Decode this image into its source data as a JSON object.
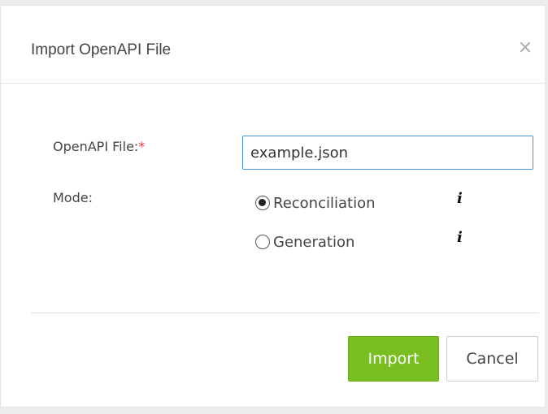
{
  "dialog": {
    "title": "Import OpenAPI File",
    "close_glyph": "×",
    "close_icon": "close-icon"
  },
  "form": {
    "file_label": "OpenAPI File:",
    "required_marker": "*",
    "file_value": "example.json",
    "mode_label": "Mode:",
    "modes": [
      {
        "label": "Reconciliation",
        "checked": true,
        "info_glyph": "i",
        "info_icon": "info-icon"
      },
      {
        "label": "Generation",
        "checked": false,
        "info_glyph": "i",
        "info_icon": "info-icon"
      }
    ]
  },
  "footer": {
    "import_label": "Import",
    "cancel_label": "Cancel"
  },
  "colors": {
    "accent_button": "#78be20",
    "input_focus_border": "#4a90d9",
    "required": "#e23d3d"
  }
}
